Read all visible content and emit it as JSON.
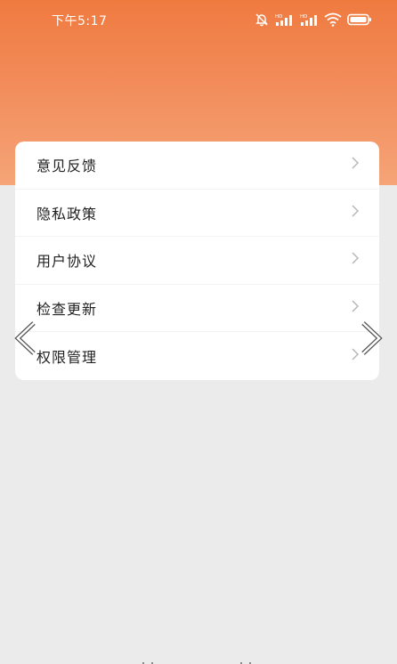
{
  "status_bar": {
    "time": "下午5:17",
    "icons": [
      "mute-bell-icon",
      "hd-signal-icon",
      "hd-signal-icon",
      "wifi-icon",
      "battery-icon"
    ]
  },
  "menu": {
    "items": [
      {
        "label": "意见反馈"
      },
      {
        "label": "隐私政策"
      },
      {
        "label": "用户协议"
      },
      {
        "label": "检查更新"
      },
      {
        "label": "权限管理"
      }
    ]
  },
  "colors": {
    "header_top": "#ef7a40",
    "header_bottom": "#f5a478",
    "background": "#ebebeb",
    "card": "#ffffff",
    "chevron": "#b8b8b8"
  },
  "tabbar": {
    "icons": [
      "scan-icon",
      "calendar-icon",
      "calendar-icon",
      "profile-icon"
    ]
  }
}
